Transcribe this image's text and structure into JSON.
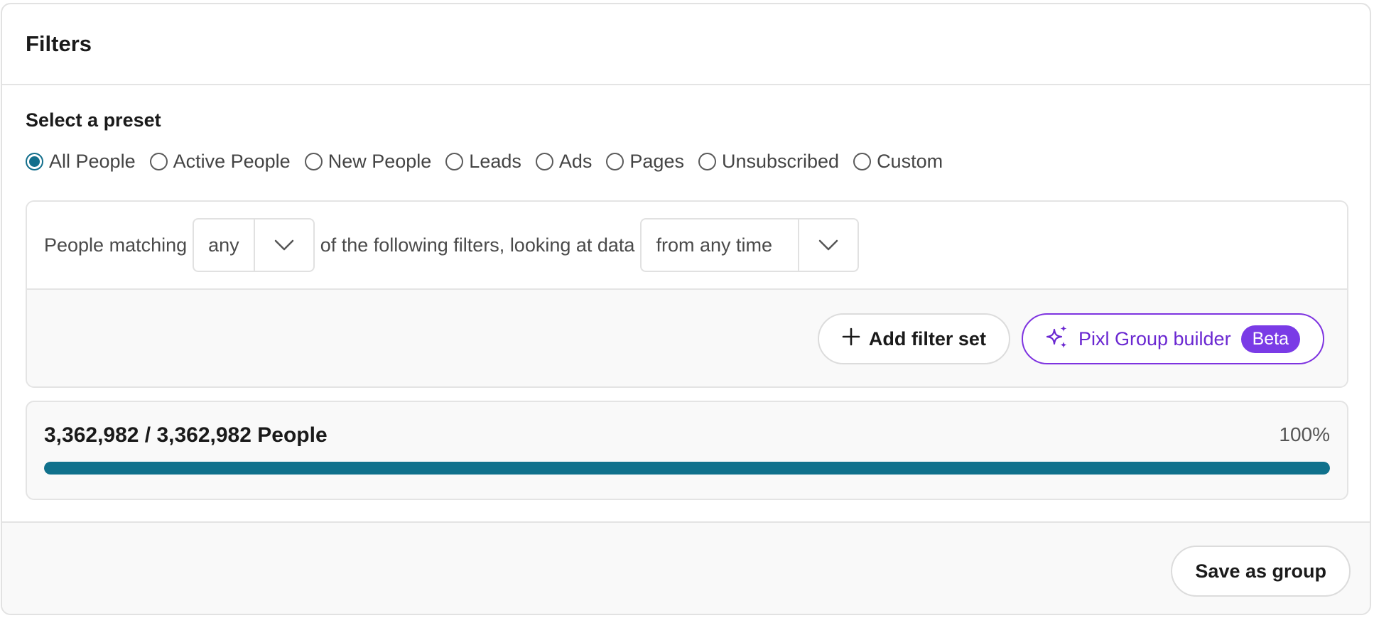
{
  "header": {
    "title": "Filters"
  },
  "presets": {
    "label": "Select a preset",
    "options": [
      {
        "label": "All People",
        "checked": true
      },
      {
        "label": "Active People",
        "checked": false
      },
      {
        "label": "New People",
        "checked": false
      },
      {
        "label": "Leads",
        "checked": false
      },
      {
        "label": "Ads",
        "checked": false
      },
      {
        "label": "Pages",
        "checked": false
      },
      {
        "label": "Unsubscribed",
        "checked": false
      },
      {
        "label": "Custom",
        "checked": false
      }
    ]
  },
  "filters": {
    "prefix": "People matching",
    "match_select": {
      "value": "any"
    },
    "middle": "of the following filters, looking at data",
    "time_select": {
      "value": "from any time"
    },
    "add_filter_set_label": "Add filter set",
    "pixl_builder_label": "Pixl Group builder",
    "beta_badge": "Beta"
  },
  "summary": {
    "count_text": "3,362,982 / 3,362,982 People",
    "percent_text": "100%",
    "progress": 1.0
  },
  "footer": {
    "save_label": "Save as group"
  },
  "colors": {
    "accent": "#136f8c",
    "progress": "#10718c",
    "pixl": "#7a3be6"
  }
}
